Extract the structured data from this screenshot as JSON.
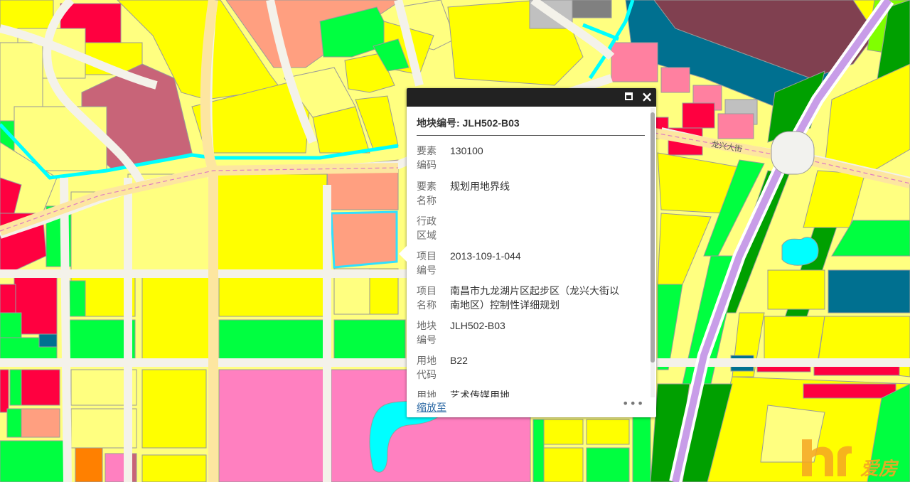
{
  "map": {
    "road_labels": [
      "龙兴大街"
    ],
    "colors": {
      "residential": "#ffff00",
      "residential_light": "#ffff80",
      "commercial": "#ff9f80",
      "entertainment": "#ff80c0",
      "public": "#c86478",
      "red": "#ff0040",
      "green": "#00ff40",
      "dark_green": "#00a000",
      "water": "#00ffff",
      "teal": "#007090",
      "road": "#fde6a0",
      "highway": "#c89de8",
      "selection_outline": "#30e0ff"
    }
  },
  "popup": {
    "title": "地块编号: JLH502-B03",
    "attributes": [
      {
        "key": "要素编码",
        "value": "130100"
      },
      {
        "key": "要素名称",
        "value": "规划用地界线"
      },
      {
        "key": "行政区域",
        "value": ""
      },
      {
        "key": "项目编号",
        "value": "2013-109-1-044"
      },
      {
        "key": "项目名称",
        "value": "南昌市九龙湖片区起步区（龙兴大街以南地区）控制性详细规划"
      },
      {
        "key": "地块编号",
        "value": "JLH502-B03"
      },
      {
        "key": "用地代码",
        "value": "B22"
      },
      {
        "key": "用地名称",
        "value": "艺术传媒用地"
      }
    ],
    "zoom_link": "缩放至",
    "more_icon": "ellipsis-icon",
    "maximize_icon": "maximize-icon",
    "close_icon": "close-icon"
  },
  "watermark": {
    "text": "爱房",
    "logo_letters": "hr"
  }
}
